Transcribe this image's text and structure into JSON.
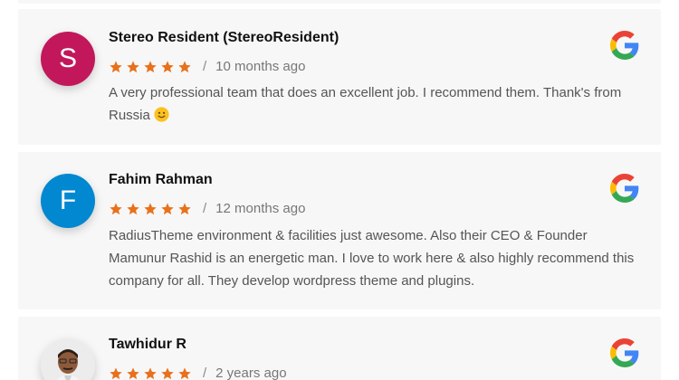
{
  "reviews": [
    {
      "avatar_letter": "S",
      "avatar_color": "#c2185b",
      "name": "Stereo Resident (StereoResident)",
      "rating": 5,
      "time": "10 months ago",
      "text": "A very professional team that does an excellent job. I recommend them. Thank's from Russia",
      "emoji": "slightly-smiling-face-emoji",
      "source_icon": "google-icon"
    },
    {
      "avatar_letter": "F",
      "avatar_color": "#0288d1",
      "name": "Fahim Rahman",
      "rating": 5,
      "time": "12 months ago",
      "text": "RadiusTheme environment & facilities just awesome. Also their CEO & Founder Mamunur Rashid is an energetic man. I love to work here & also highly recommend this company for all. They develop wordpress theme and plugins.",
      "source_icon": "google-icon"
    },
    {
      "avatar_photo": "person-photo",
      "name": "Tawhidur R",
      "rating": 5,
      "time": "2 years ago",
      "source_icon": "google-icon"
    }
  ],
  "separator": "/",
  "colors": {
    "star": "#e8711c",
    "card_bg": "#f7f7f7"
  }
}
